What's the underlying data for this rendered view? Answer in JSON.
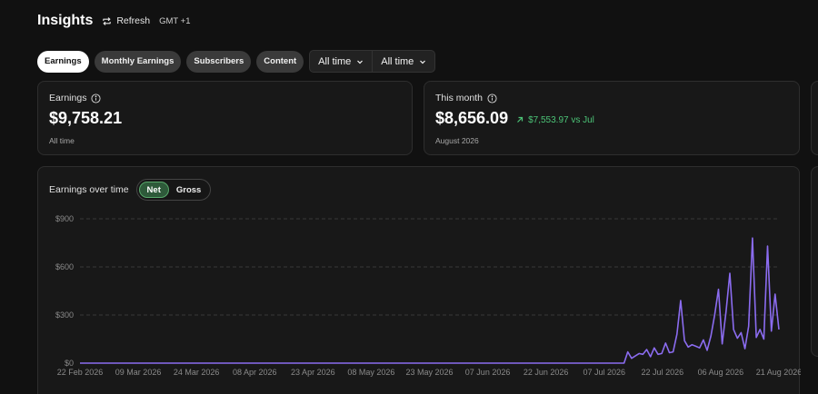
{
  "header": {
    "title": "Insights",
    "refresh_label": "Refresh",
    "timezone": "GMT +1"
  },
  "filters": {
    "pills": [
      {
        "label": "Earnings",
        "active": true
      },
      {
        "label": "Monthly Earnings",
        "active": false
      },
      {
        "label": "Subscribers",
        "active": false
      },
      {
        "label": "Content",
        "active": false
      }
    ],
    "dropdowns": [
      {
        "label": "All time"
      },
      {
        "label": "All time"
      }
    ]
  },
  "earnings_card": {
    "label": "Earnings",
    "value": "$9,758.21",
    "sub": "All time"
  },
  "month_card": {
    "label": "This month",
    "value": "$8,656.09",
    "delta": "$7,553.97 vs Jul",
    "sub": "August 2026",
    "delta_color": "#4cc477"
  },
  "chart": {
    "title": "Earnings over time",
    "toggle": [
      {
        "label": "Net",
        "active": true
      },
      {
        "label": "Gross",
        "active": false
      }
    ]
  },
  "colors": {
    "accent_line": "#8b6cf0",
    "positive": "#4cc477",
    "toggle_active": "#2e5a3a"
  },
  "chart_data": {
    "type": "line",
    "ylim": [
      0,
      900
    ],
    "yticks": [
      "$0",
      "$300",
      "$600",
      "$900"
    ],
    "ytick_values": [
      0,
      300,
      600,
      900
    ],
    "xticks": [
      "22 Feb 2026",
      "09 Mar 2026",
      "24 Mar 2026",
      "08 Apr 2026",
      "23 Apr 2026",
      "08 May 2026",
      "23 May 2026",
      "07 Jun 2026",
      "22 Jun 2026",
      "07 Jul 2026",
      "22 Jul 2026",
      "06 Aug 2026",
      "21 Aug 2026"
    ],
    "grid": true,
    "series": [
      {
        "values": [
          0,
          0,
          0,
          0,
          0,
          0,
          0,
          0,
          0,
          0,
          0,
          0,
          0,
          0,
          0,
          0,
          0,
          0,
          0,
          0,
          0,
          0,
          0,
          0,
          0,
          0,
          0,
          0,
          0,
          0,
          0,
          0,
          0,
          0,
          0,
          0,
          0,
          0,
          0,
          0,
          0,
          0,
          0,
          0,
          0,
          0,
          0,
          0,
          0,
          0,
          0,
          0,
          0,
          0,
          0,
          0,
          0,
          0,
          0,
          0,
          0,
          0,
          0,
          0,
          0,
          0,
          0,
          0,
          0,
          0,
          0,
          0,
          0,
          0,
          0,
          0,
          0,
          0,
          0,
          0,
          0,
          0,
          0,
          0,
          0,
          0,
          0,
          0,
          0,
          0,
          0,
          0,
          0,
          0,
          0,
          0,
          0,
          0,
          0,
          0,
          0,
          0,
          0,
          0,
          0,
          0,
          0,
          0,
          0,
          0,
          0,
          0,
          0,
          0,
          0,
          0,
          0,
          0,
          0,
          0,
          0,
          0,
          0,
          0,
          0,
          0,
          0,
          0,
          0,
          0,
          0,
          0,
          0,
          0,
          0,
          0,
          0,
          0,
          0,
          0,
          0,
          0,
          0,
          0,
          0,
          70,
          30,
          45,
          60,
          55,
          85,
          40,
          95,
          55,
          60,
          125,
          65,
          70,
          180,
          390,
          140,
          100,
          115,
          105,
          95,
          145,
          80,
          170,
          300,
          460,
          120,
          320,
          560,
          210,
          155,
          190,
          90,
          230,
          780,
          160,
          210,
          150,
          730,
          200,
          430,
          210
        ]
      }
    ]
  }
}
